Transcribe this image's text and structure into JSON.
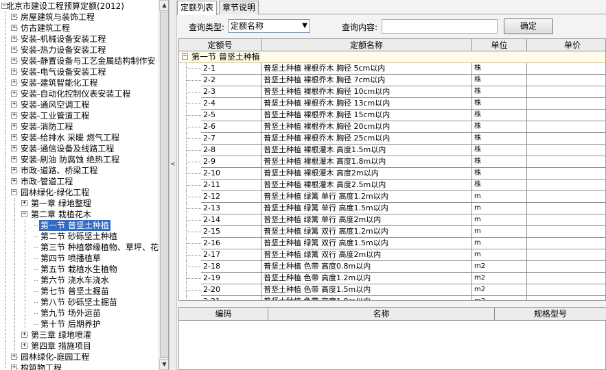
{
  "tree": {
    "root": "北京市建设工程预算定额(2012)",
    "items": [
      {
        "label": "房屋建筑与装饰工程",
        "expanded": false
      },
      {
        "label": "仿古建筑工程",
        "expanded": false
      },
      {
        "label": "安装-机械设备安装工程",
        "expanded": false
      },
      {
        "label": "安装-热力设备安装工程",
        "expanded": false
      },
      {
        "label": "安装-静置设备与工艺金属结构制作安",
        "expanded": false
      },
      {
        "label": "安装-电气设备安装工程",
        "expanded": false
      },
      {
        "label": "安装-建筑智能化工程",
        "expanded": false
      },
      {
        "label": "安装-自动化控制仪表安装工程",
        "expanded": false
      },
      {
        "label": "安装-通风空调工程",
        "expanded": false
      },
      {
        "label": "安装-工业管道工程",
        "expanded": false
      },
      {
        "label": "安装-消防工程",
        "expanded": false
      },
      {
        "label": "安装-给排水 采暖 燃气工程",
        "expanded": false
      },
      {
        "label": "安装-通信设备及线路工程",
        "expanded": false
      },
      {
        "label": "安装-刷油 防腐蚀 绝热工程",
        "expanded": false
      },
      {
        "label": "市政-道路、桥梁工程",
        "expanded": false
      },
      {
        "label": "市政-管道工程",
        "expanded": false
      },
      {
        "label": "园林绿化-绿化工程",
        "expanded": true
      },
      {
        "label": "园林绿化-庭园工程",
        "expanded": false
      },
      {
        "label": "构筑物工程",
        "expanded": false
      }
    ],
    "landscape_children": [
      {
        "label": "第一章 绿地整理",
        "expanded": false
      },
      {
        "label": "第二章 栽植花木",
        "expanded": true
      },
      {
        "label": "第三章 绿地喷灌",
        "expanded": false
      },
      {
        "label": "第四章 措施项目",
        "expanded": false
      }
    ],
    "chapter2_sections": [
      {
        "label": "第一节 普坚土种植",
        "selected": true
      },
      {
        "label": "第二节 砂砾坚土种植",
        "selected": false
      },
      {
        "label": "第三节 种植攀缘植物、草坪、花",
        "selected": false
      },
      {
        "label": "第四节 喷播植草",
        "selected": false
      },
      {
        "label": "第五节 栽植水生植物",
        "selected": false
      },
      {
        "label": "第六节 浇水车浇水",
        "selected": false
      },
      {
        "label": "第七节 普坚土掘苗",
        "selected": false
      },
      {
        "label": "第八节 砂砾坚土掘苗",
        "selected": false
      },
      {
        "label": "第九节 场外运苗",
        "selected": false
      },
      {
        "label": "第十节 后期养护",
        "selected": false
      }
    ],
    "expander_plus": "+",
    "expander_minus": "−"
  },
  "tabs": [
    {
      "label": "定额列表",
      "active": true
    },
    {
      "label": "章节说明",
      "active": false
    }
  ],
  "query": {
    "type_label": "查询类型:",
    "type_value": "定额名称",
    "content_label": "查询内容:",
    "content_value": "",
    "confirm": "确定"
  },
  "grid": {
    "columns": [
      "定额号",
      "定额名称",
      "单位",
      "单价"
    ],
    "group_label": "第一节 普坚土种植",
    "rows": [
      {
        "code": "2-1",
        "name": "普坚土种植 裸根乔木 胸径 5cm以内",
        "unit": "株"
      },
      {
        "code": "2-2",
        "name": "普坚土种植 裸根乔木 胸径 7cm以内",
        "unit": "株"
      },
      {
        "code": "2-3",
        "name": "普坚土种植 裸根乔木 胸径 10cm以内",
        "unit": "株"
      },
      {
        "code": "2-4",
        "name": "普坚土种植 裸根乔木 胸径 13cm以内",
        "unit": "株"
      },
      {
        "code": "2-5",
        "name": "普坚土种植 裸根乔木 胸径 15cm以内",
        "unit": "株"
      },
      {
        "code": "2-6",
        "name": "普坚土种植 裸根乔木 胸径 20cm以内",
        "unit": "株"
      },
      {
        "code": "2-7",
        "name": "普坚土种植 裸根乔木 胸径 25cm以内",
        "unit": "株"
      },
      {
        "code": "2-8",
        "name": "普坚土种植 裸根灌木 高度1.5m以内",
        "unit": "株"
      },
      {
        "code": "2-9",
        "name": "普坚土种植 裸根灌木 高度1.8m以内",
        "unit": "株"
      },
      {
        "code": "2-10",
        "name": "普坚土种植 裸根灌木 高度2m以内",
        "unit": "株"
      },
      {
        "code": "2-11",
        "name": "普坚土种植 裸根灌木 高度2.5m以内",
        "unit": "株"
      },
      {
        "code": "2-12",
        "name": "普坚土种植 绿篱 单行 高度1.2m以内",
        "unit": "m"
      },
      {
        "code": "2-13",
        "name": "普坚土种植 绿篱 单行 高度1.5m以内",
        "unit": "m"
      },
      {
        "code": "2-14",
        "name": "普坚土种植 绿篱 单行 高度2m以内",
        "unit": "m"
      },
      {
        "code": "2-15",
        "name": "普坚土种植 绿篱 双行 高度1.2m以内",
        "unit": "m"
      },
      {
        "code": "2-16",
        "name": "普坚土种植 绿篱 双行 高度1.5m以内",
        "unit": "m"
      },
      {
        "code": "2-17",
        "name": "普坚土种植 绿篱 双行 高度2m以内",
        "unit": "m"
      },
      {
        "code": "2-18",
        "name": "普坚土种植 色带 高度0.8m以内",
        "unit": "m2"
      },
      {
        "code": "2-19",
        "name": "普坚土种植 色带 高度1.2m以内",
        "unit": "m2"
      },
      {
        "code": "2-20",
        "name": "普坚土种植 色带 高度1.5m以内",
        "unit": "m2"
      },
      {
        "code": "2-21",
        "name": "普坚土种植 色带 高度1.8m以内",
        "unit": "m2"
      }
    ]
  },
  "grid2": {
    "columns": [
      "编码",
      "名称",
      "规格型号"
    ]
  },
  "icons": {
    "splitter_arrow": "<",
    "select_arrow": "▼",
    "scroll_up": "▲",
    "scroll_down": "▼"
  },
  "colors": {
    "selection": "#316ac5",
    "group_row_bg": "#fffbe6"
  }
}
